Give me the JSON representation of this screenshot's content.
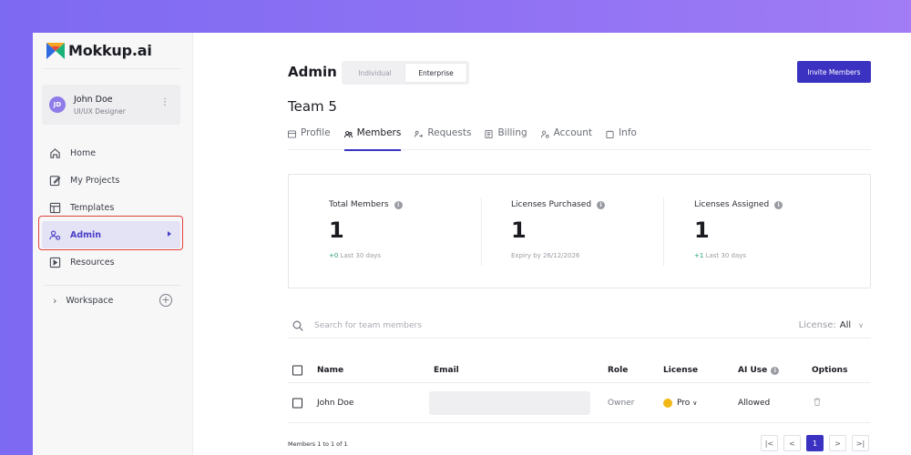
{
  "brand": {
    "name": "Mokkup.ai"
  },
  "user": {
    "initials": "JD",
    "name": "John Doe",
    "role": "UI/UX Designer"
  },
  "sidebar": {
    "items": [
      {
        "label": "Home",
        "icon": "home-icon"
      },
      {
        "label": "My Projects",
        "icon": "edit-icon"
      },
      {
        "label": "Templates",
        "icon": "template-icon"
      },
      {
        "label": "Admin",
        "icon": "admin-icon",
        "active": true
      },
      {
        "label": "Resources",
        "icon": "play-icon"
      }
    ],
    "workspace_label": "Workspace"
  },
  "header": {
    "title": "Admin",
    "segments": [
      "Individual",
      "Enterprise"
    ],
    "selected_segment": "Enterprise",
    "invite_label": "Invite Members"
  },
  "team": {
    "title": "Team 5"
  },
  "tabs": [
    {
      "label": "Profile",
      "icon": "profile-icon"
    },
    {
      "label": "Members",
      "icon": "members-icon",
      "active": true
    },
    {
      "label": "Requests",
      "icon": "requests-icon"
    },
    {
      "label": "Billing",
      "icon": "billing-icon"
    },
    {
      "label": "Account",
      "icon": "account-icon"
    },
    {
      "label": "Info",
      "icon": "info-icon"
    }
  ],
  "stats": [
    {
      "label": "Total Members",
      "value": "1",
      "delta": "+0",
      "sub": "Last 30 days"
    },
    {
      "label": "Licenses Purchased",
      "value": "1",
      "delta": "",
      "sub": "Expiry by 26/12/2026"
    },
    {
      "label": "Licenses Assigned",
      "value": "1",
      "delta": "+1",
      "sub": "Last 30 days"
    }
  ],
  "search": {
    "placeholder": "Search for team members",
    "filter_label": "License:",
    "filter_value": "All"
  },
  "table": {
    "columns": [
      "Name",
      "Email",
      "Role",
      "License",
      "AI Use",
      "Options"
    ],
    "rows": [
      {
        "name": "John Doe",
        "email": "",
        "role": "Owner",
        "license": "Pro",
        "ai_use": "Allowed"
      }
    ]
  },
  "footer": {
    "summary": "Members 1 to 1 of 1"
  },
  "pagination": {
    "first": "|<",
    "prev": "<",
    "current": "1",
    "next": ">",
    "last": ">|"
  },
  "colors": {
    "accent": "#3b32c2",
    "highlight": "#e0433a",
    "positive": "#24a06b"
  }
}
